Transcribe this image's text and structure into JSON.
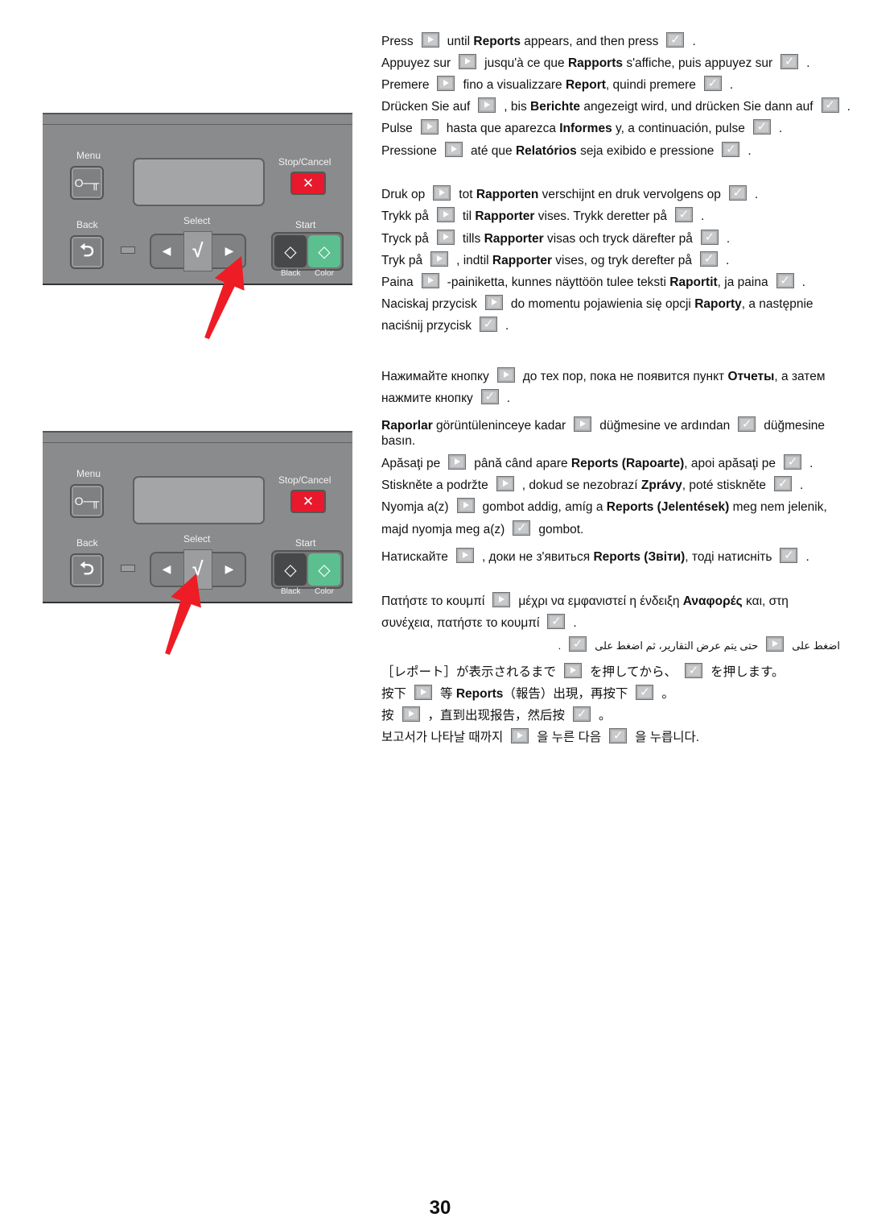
{
  "panel": {
    "menu": "Menu",
    "stop_cancel": "Stop/Cancel",
    "back": "Back",
    "select": "Select",
    "start": "Start",
    "black": "Black",
    "color": "Color"
  },
  "lines": [
    [
      {
        "t": "Press"
      },
      {
        "i": "r"
      },
      {
        "t": "until "
      },
      {
        "b": "Reports"
      },
      {
        "t": " appears, and then press"
      },
      {
        "i": "c"
      },
      {
        "t": "."
      }
    ],
    [
      {
        "t": "Appuyez sur"
      },
      {
        "i": "r"
      },
      {
        "t": "jusqu'à ce que "
      },
      {
        "b": "Rapports"
      },
      {
        "t": " s'affiche, puis appuyez sur"
      },
      {
        "i": "c"
      },
      {
        "t": "."
      }
    ],
    [
      {
        "t": "Premere"
      },
      {
        "i": "r"
      },
      {
        "t": "fino a visualizzare "
      },
      {
        "b": "Report"
      },
      {
        "t": ", quindi premere"
      },
      {
        "i": "c"
      },
      {
        "t": "."
      }
    ],
    [
      {
        "t": "Drücken Sie auf"
      },
      {
        "i": "r"
      },
      {
        "t": ", bis "
      },
      {
        "b": "Berichte"
      },
      {
        "t": " angezeigt wird, und drücken Sie dann auf"
      },
      {
        "i": "c"
      },
      {
        "t": "."
      }
    ],
    [
      {
        "t": "Pulse"
      },
      {
        "i": "r"
      },
      {
        "t": "hasta que aparezca "
      },
      {
        "b": "Informes"
      },
      {
        "t": " y, a continuación, pulse"
      },
      {
        "i": "c"
      },
      {
        "t": "."
      }
    ],
    [
      {
        "t": "Pressione"
      },
      {
        "i": "r"
      },
      {
        "t": "até que "
      },
      {
        "b": "Relatórios"
      },
      {
        "t": " seja exibido e pressione"
      },
      {
        "i": "c"
      },
      {
        "t": "."
      }
    ],
    [
      {
        "t": "Druk op"
      },
      {
        "i": "r"
      },
      {
        "t": "tot "
      },
      {
        "b": "Rapporten"
      },
      {
        "t": " verschijnt en druk vervolgens op"
      },
      {
        "i": "c"
      },
      {
        "t": "."
      }
    ],
    [
      {
        "t": "Trykk på"
      },
      {
        "i": "r"
      },
      {
        "t": "til "
      },
      {
        "b": "Rapporter"
      },
      {
        "t": " vises. Trykk deretter på"
      },
      {
        "i": "c"
      },
      {
        "t": "."
      }
    ],
    [
      {
        "t": "Tryck på"
      },
      {
        "i": "r"
      },
      {
        "t": "tills "
      },
      {
        "b": "Rapporter"
      },
      {
        "t": " visas och tryck därefter på"
      },
      {
        "i": "c"
      },
      {
        "t": "."
      }
    ],
    [
      {
        "t": "Tryk på"
      },
      {
        "i": "r"
      },
      {
        "t": ", indtil "
      },
      {
        "b": "Rapporter"
      },
      {
        "t": " vises, og tryk derefter på"
      },
      {
        "i": "c"
      },
      {
        "t": "."
      }
    ],
    [
      {
        "t": "Paina"
      },
      {
        "i": "r"
      },
      {
        "t": "-painiketta, kunnes näyttöön tulee teksti "
      },
      {
        "b": "Raportit"
      },
      {
        "t": ", ja paina"
      },
      {
        "i": "c"
      },
      {
        "t": "."
      }
    ],
    [
      {
        "t": "Naciskaj przycisk"
      },
      {
        "i": "r"
      },
      {
        "t": "do momentu pojawienia się opcji "
      },
      {
        "b": "Raporty"
      },
      {
        "t": ", a następnie"
      }
    ],
    [
      {
        "t": "naciśnij przycisk"
      },
      {
        "i": "c"
      },
      {
        "t": "."
      }
    ],
    [
      {
        "t": "Нажимайте кнопку"
      },
      {
        "i": "r"
      },
      {
        "t": "до тех пор, пока не появится пункт "
      },
      {
        "b": "Отчеты"
      },
      {
        "t": ", а затем"
      }
    ],
    [
      {
        "t": "нажмите кнопку"
      },
      {
        "i": "c"
      },
      {
        "t": "."
      }
    ],
    [
      {
        "b": "Raporlar"
      },
      {
        "t": " görüntüleninceye kadar"
      },
      {
        "i": "r"
      },
      {
        "t": "düğmesine ve ardından"
      },
      {
        "i": "c"
      },
      {
        "t": "düğmesine"
      }
    ],
    [
      {
        "t": "basın."
      }
    ],
    [
      {
        "t": "Apăsaţi pe"
      },
      {
        "i": "r"
      },
      {
        "t": "până când apare "
      },
      {
        "b": "Reports (Rapoarte)"
      },
      {
        "t": ", apoi apăsaţi pe"
      },
      {
        "i": "c"
      },
      {
        "t": "."
      }
    ],
    [
      {
        "t": "Stiskněte a podržte"
      },
      {
        "i": "r"
      },
      {
        "t": ", dokud se nezobrazí "
      },
      {
        "b": "Zprávy"
      },
      {
        "t": ", poté stiskněte"
      },
      {
        "i": "c"
      },
      {
        "t": "."
      }
    ],
    [
      {
        "t": "Nyomja a(z)"
      },
      {
        "i": "r"
      },
      {
        "t": "gombot addig, amíg a "
      },
      {
        "b": "Reports (Jelentések)"
      },
      {
        "t": " meg nem jelenik,"
      }
    ],
    [
      {
        "t": "majd nyomja meg a(z)"
      },
      {
        "i": "c"
      },
      {
        "t": "gombot."
      }
    ],
    [
      {
        "t": "Натискайте"
      },
      {
        "i": "r"
      },
      {
        "t": ", доки не з'явиться "
      },
      {
        "b": "Reports (Звіти)"
      },
      {
        "t": ", тоді натисніть"
      },
      {
        "i": "c"
      },
      {
        "t": "."
      }
    ],
    [
      {
        "t": "Πατήστε το κουμπί"
      },
      {
        "i": "r"
      },
      {
        "t": "μέχρι να εμφανιστεί η ένδειξη "
      },
      {
        "b": "Αναφορές"
      },
      {
        "t": " και, στη"
      }
    ],
    [
      {
        "t": "συνέχεια, πατήστε το κουμπί"
      },
      {
        "i": "c"
      },
      {
        "t": "."
      }
    ],
    [
      {
        "t": "اضغط على"
      },
      {
        "i": "r"
      },
      {
        "t": "حتى يتم عرض التقارير، ثم اضغط على"
      },
      {
        "i": "c"
      },
      {
        "t": "."
      }
    ],
    [
      {
        "t": "［レポート］が表示されるまで"
      },
      {
        "i": "r"
      },
      {
        "t": "を押してから、"
      },
      {
        "i": "c"
      },
      {
        "t": "を押します。"
      }
    ],
    [
      {
        "t": "按下"
      },
      {
        "i": "r"
      },
      {
        "t": "等 "
      },
      {
        "b": "Reports"
      },
      {
        "t": "（報告）出現，再按下"
      },
      {
        "i": "c"
      },
      {
        "t": "。"
      }
    ],
    [
      {
        "t": "按"
      },
      {
        "i": "r"
      },
      {
        "t": "，直到出现报告，然后按"
      },
      {
        "i": "c"
      },
      {
        "t": "。"
      }
    ],
    [
      {
        "t": "보고서가 나타날 때까지"
      },
      {
        "i": "r"
      },
      {
        "t": "을 누른 다음"
      },
      {
        "i": "c"
      },
      {
        "t": "을 누릅니다."
      }
    ]
  ],
  "page_number": "30",
  "colors": {
    "panel": "#8a8b8d",
    "stop": "#e8192c",
    "start_color": "#5cbf8f",
    "arrow": "#ee1c25"
  }
}
